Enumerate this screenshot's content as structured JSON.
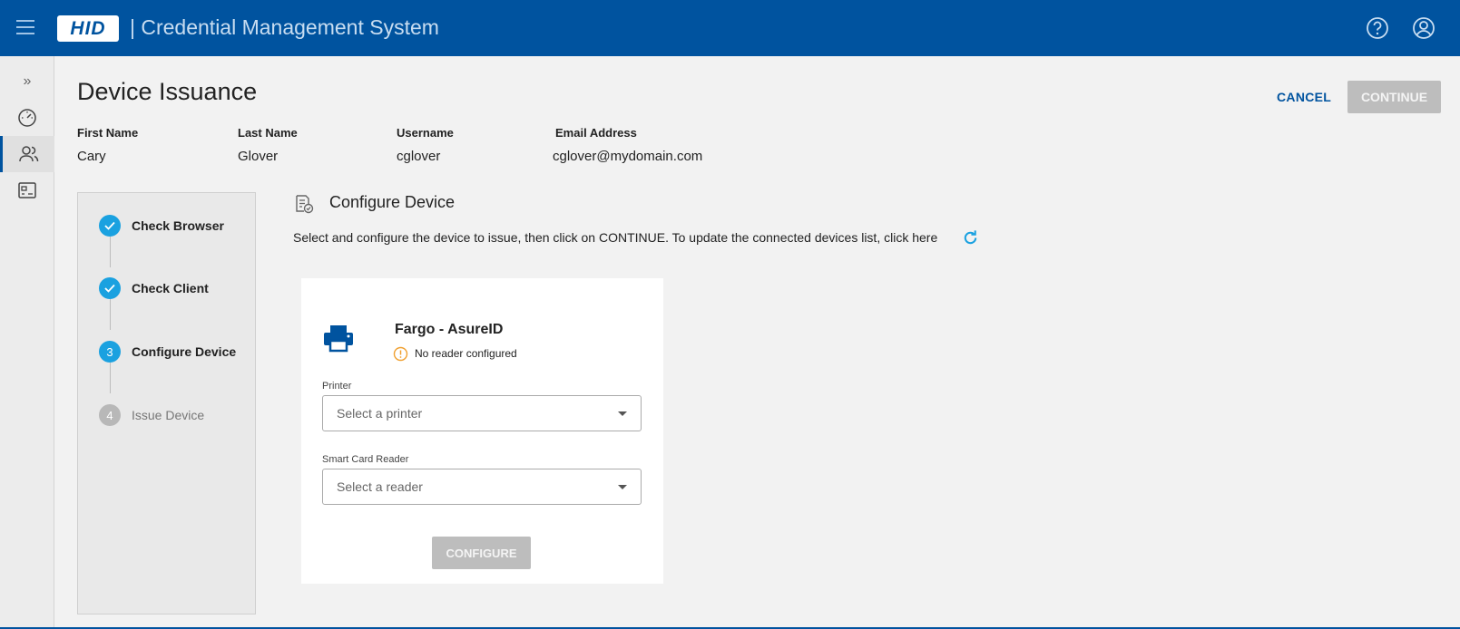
{
  "header": {
    "logo_text": "HID",
    "app_title": "| Credential Management System"
  },
  "page": {
    "title": "Device Issuance",
    "cancel_label": "CANCEL",
    "continue_label": "CONTINUE"
  },
  "user_info": [
    {
      "label": "First Name",
      "value": "Cary"
    },
    {
      "label": "Last Name",
      "value": "Glover"
    },
    {
      "label": "Username",
      "value": "cglover"
    },
    {
      "label": "Email Address",
      "value": "cglover@mydomain.com"
    }
  ],
  "steps": [
    {
      "number": "1",
      "label": "Check Browser",
      "status": "done"
    },
    {
      "number": "2",
      "label": "Check Client",
      "status": "done"
    },
    {
      "number": "3",
      "label": "Configure Device",
      "status": "current"
    },
    {
      "number": "4",
      "label": "Issue Device",
      "status": "pending"
    }
  ],
  "section": {
    "title": "Configure Device",
    "instruction": "Select and configure the device to issue, then click on CONTINUE. To update the connected devices list, click here"
  },
  "device": {
    "name": "Fargo - AsureID",
    "status_text": "No reader configured",
    "printer_label": "Printer",
    "printer_placeholder": "Select a printer",
    "reader_label": "Smart Card Reader",
    "reader_placeholder": "Select a reader",
    "configure_label": "CONFIGURE"
  },
  "colors": {
    "brand": "#00539f",
    "step_active": "#1aa1e0",
    "warning": "#f0a030"
  }
}
